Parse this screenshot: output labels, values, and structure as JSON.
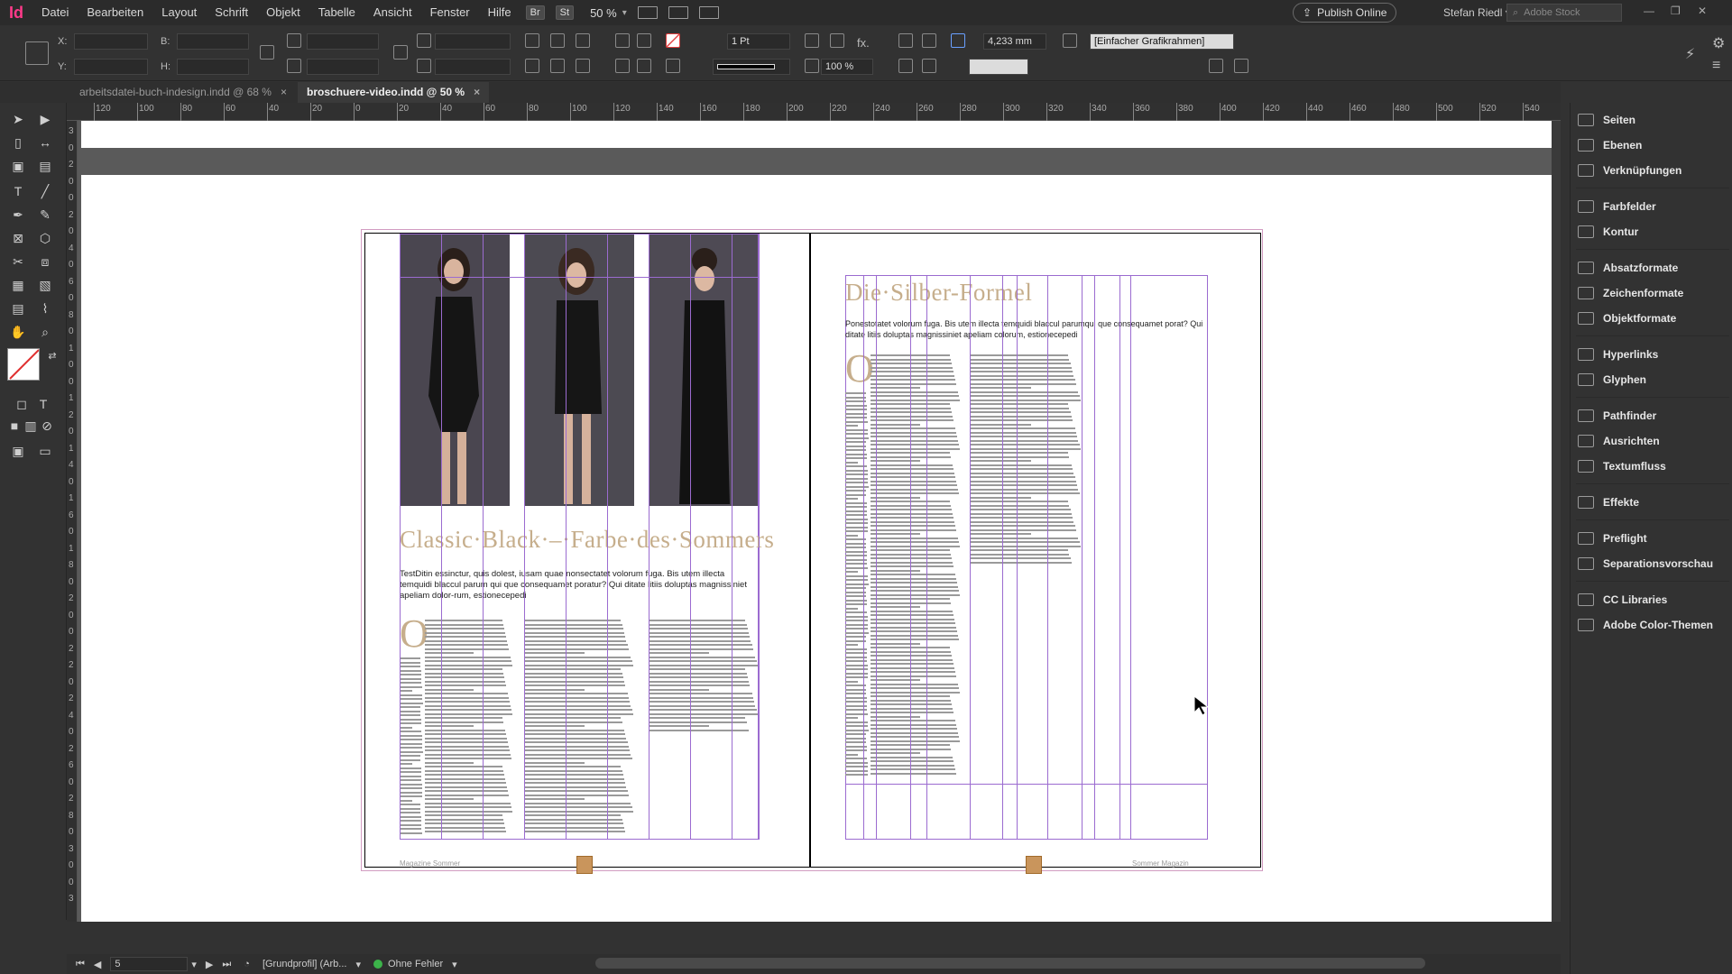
{
  "menubar": {
    "logo": "Id",
    "items": [
      "Datei",
      "Bearbeiten",
      "Layout",
      "Schrift",
      "Objekt",
      "Tabelle",
      "Ansicht",
      "Fenster",
      "Hilfe"
    ],
    "bridge": "Br",
    "stock_btn": "St",
    "zoom": "50 %",
    "publish": "Publish Online",
    "user": "Stefan Riedl",
    "search_placeholder": "Adobe Stock"
  },
  "controlbar": {
    "x_label": "X:",
    "y_label": "Y:",
    "b_label": "B:",
    "h_label": "H:",
    "stroke_weight": "1 Pt",
    "opacity": "100 %",
    "dimension": "4,233 mm",
    "frame_style": "[Einfacher Grafikrahmen]",
    "fx": "fx."
  },
  "tabs": [
    {
      "label": "arbeitsdatei-buch-indesign.indd @ 68 %",
      "active": false
    },
    {
      "label": "broschuere-video.indd @ 50 %",
      "active": true
    }
  ],
  "ruler": {
    "h_ticks": [
      "120",
      "100",
      "80",
      "60",
      "40",
      "20",
      "0",
      "20",
      "40",
      "60",
      "80",
      "100",
      "120",
      "140",
      "160",
      "180",
      "200",
      "220",
      "240",
      "260",
      "280",
      "300",
      "320",
      "340",
      "360",
      "380",
      "400",
      "420",
      "440",
      "460",
      "480",
      "500",
      "520",
      "540"
    ],
    "v_ticks": [
      "3",
      "0",
      "2",
      "0",
      "0",
      "2",
      "0",
      "4",
      "0",
      "6",
      "0",
      "8",
      "0",
      "1",
      "0",
      "0",
      "1",
      "2",
      "0",
      "1",
      "4",
      "0",
      "1",
      "6",
      "0",
      "1",
      "8",
      "0",
      "2",
      "0",
      "0",
      "2",
      "2",
      "0",
      "2",
      "4",
      "0",
      "2",
      "6",
      "0",
      "2",
      "8",
      "0",
      "3",
      "0",
      "0",
      "3"
    ]
  },
  "document": {
    "left_headline": "Classic·Black·–·Farbe·des·Sommers",
    "left_intro": "TestDitin essinctur, quis dolest, iusam quae nonsectatet volorum fuga. Bis utem illecta temquidi blaccul parum qui que consequamet poratur? Qui ditate litiis doluptas magnissiniet apeliam dolor-rum, estionecepedi",
    "right_headline": "Die·Silber-Formel",
    "right_intro": "Ponestotatet volorum fuga. Bis utem illecta temquidi blaccul parumqui que consequamet porat? Qui ditate litiis doluptas magnissiniet apeliam colorum, estionecepedi",
    "dropcap": "O",
    "running_left": "Magazine Sommer",
    "running_right": "Sommer Magazin"
  },
  "panel": {
    "items": [
      "Seiten",
      "Ebenen",
      "Verknüpfungen",
      "Farbfelder",
      "Kontur",
      "Absatzformate",
      "Zeichenformate",
      "Objektformate",
      "Hyperlinks",
      "Glyphen",
      "Pathfinder",
      "Ausrichten",
      "Textumfluss",
      "Effekte",
      "Preflight",
      "Separationsvorschau",
      "CC Libraries",
      "Adobe Color-Themen"
    ]
  },
  "status": {
    "page": "5",
    "profile": "[Grundprofil] (Arb...",
    "errors": "Ohne Fehler"
  },
  "colors": {
    "accent_headline": "#c6ae8c",
    "guide": "#9b6bd0",
    "logo": "#ff3a8a",
    "status_ok": "#3cb34a"
  }
}
